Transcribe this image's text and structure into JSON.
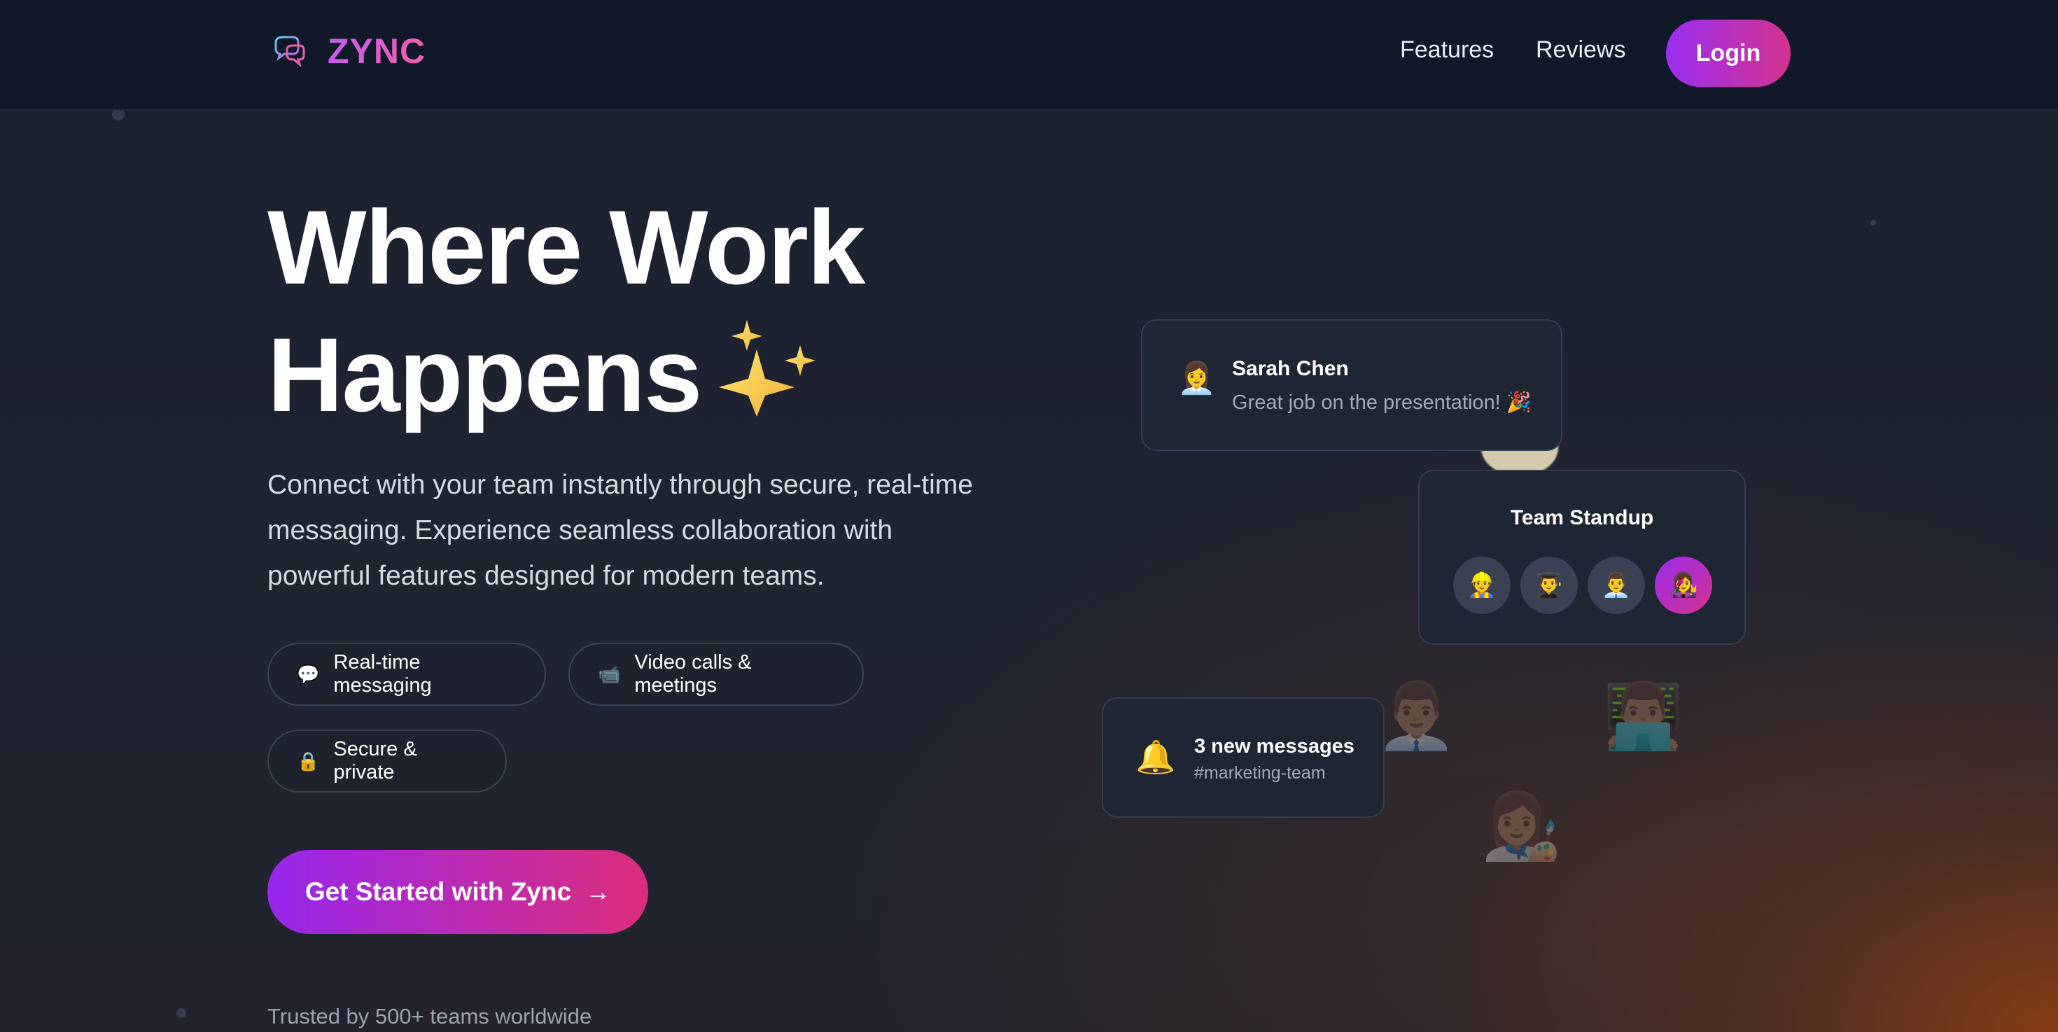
{
  "nav": {
    "brand": "ZYNC",
    "brand_icon": "chat-bubbles-icon",
    "links": [
      "Features",
      "Reviews"
    ],
    "login": "Login"
  },
  "hero": {
    "title_line1": "Where Work",
    "title_line2": "Happens",
    "title_icon": "sparkles-icon",
    "subtitle": "Connect with your team instantly through secure, real-time messaging. Experience seamless collaboration with powerful features designed for modern teams.",
    "features": [
      {
        "icon": "speech-bubble-icon",
        "glyph": "💬",
        "label": "Real-time messaging"
      },
      {
        "icon": "video-camera-icon",
        "glyph": "📹",
        "label": "Video calls & meetings"
      },
      {
        "icon": "lock-icon",
        "glyph": "🔒",
        "label": "Secure & private"
      }
    ],
    "cta": "Get Started with Zync",
    "cta_arrow": "→",
    "trusted": "Trusted by 500+ teams worldwide"
  },
  "illustration": {
    "message_card": {
      "avatar": "👩‍💼",
      "name": "Sarah Chen",
      "text": "Great job on the presentation! 🎉"
    },
    "standup_card": {
      "title": "Team Standup",
      "avatars": [
        "👷",
        "👨‍🎓",
        "👨‍💼",
        "👩‍🎤"
      ]
    },
    "notification_card": {
      "icon": "🔔",
      "title": "3 new messages",
      "channel": "#marketing-team"
    },
    "background_people": [
      "👨🏽‍💼",
      "👨🏽‍💻",
      "👩🏽‍🎨"
    ]
  },
  "colors": {
    "accent_start": "#9b2ef0",
    "accent_end": "#d3338f",
    "background": "#1a1f2c",
    "navbar": "#111827"
  }
}
